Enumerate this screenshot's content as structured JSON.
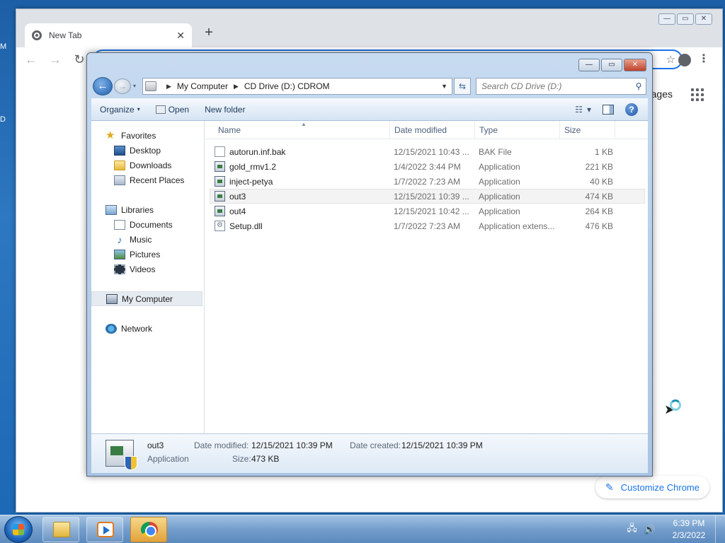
{
  "desktop": {
    "edge_glyph_1": "M",
    "edge_glyph_2": "D"
  },
  "chrome": {
    "tab_title": "New Tab",
    "tab_close": "✕",
    "new_tab": "+",
    "back": "←",
    "forward": "→",
    "reload": "↻",
    "star": "☆",
    "menu": "⋮",
    "images_link": "ages",
    "customize_label": "Customize Chrome",
    "customize_icon": "✎",
    "win_min": "—",
    "win_max": "▭",
    "win_close": "✕"
  },
  "explorer": {
    "caption": {
      "min": "—",
      "max": "▭",
      "close": "✕"
    },
    "nav": {
      "back": "←",
      "forward": "→",
      "history": "▾",
      "refresh": "⇆"
    },
    "breadcrumb": [
      "My Computer",
      "CD Drive (D:) CDROM"
    ],
    "breadcrumb_sep": "▶",
    "address_dropdown": "▼",
    "search_placeholder": "Search CD Drive (D:)",
    "search_icon": "⚲",
    "commands": {
      "organize": "Organize",
      "open": "Open",
      "new_folder": "New folder",
      "dropdown": "▾",
      "help": "?"
    },
    "sidebar": {
      "favorites": {
        "label": "Favorites",
        "items": [
          "Desktop",
          "Downloads",
          "Recent Places"
        ]
      },
      "libraries": {
        "label": "Libraries",
        "items": [
          "Documents",
          "Music",
          "Pictures",
          "Videos"
        ]
      },
      "computer": "My Computer",
      "network": "Network"
    },
    "columns": {
      "name": "Name",
      "date": "Date modified",
      "type": "Type",
      "size": "Size",
      "sort_indicator": "▲"
    },
    "files": [
      {
        "name": "autorun.inf.bak",
        "date": "12/15/2021 10:43 ...",
        "type": "BAK File",
        "size": "1 KB",
        "icon": "blank-file-icon"
      },
      {
        "name": "gold_rmv1.2",
        "date": "1/4/2022 3:44 PM",
        "type": "Application",
        "size": "221 KB",
        "icon": "application-icon"
      },
      {
        "name": "inject-petya",
        "date": "1/7/2022 7:23 AM",
        "type": "Application",
        "size": "40 KB",
        "icon": "application-icon"
      },
      {
        "name": "out3",
        "date": "12/15/2021 10:39 ...",
        "type": "Application",
        "size": "474 KB",
        "icon": "application-icon",
        "selected": true
      },
      {
        "name": "out4",
        "date": "12/15/2021 10:42 ...",
        "type": "Application",
        "size": "264 KB",
        "icon": "application-icon"
      },
      {
        "name": "Setup.dll",
        "date": "1/7/2022 7:23 AM",
        "type": "Application extens...",
        "size": "476 KB",
        "icon": "dll-file-icon"
      }
    ],
    "details": {
      "name": "out3",
      "type": "Application",
      "date_modified_label": "Date modified:",
      "date_modified": "12/15/2021 10:39 PM",
      "date_created_label": "Date created:",
      "date_created": "12/15/2021 10:39 PM",
      "size_label": "Size:",
      "size": "473 KB"
    }
  },
  "taskbar": {
    "time": "6:39 PM",
    "date": "2/3/2022",
    "network_icon": "🖧",
    "volume_icon": "🔊"
  }
}
